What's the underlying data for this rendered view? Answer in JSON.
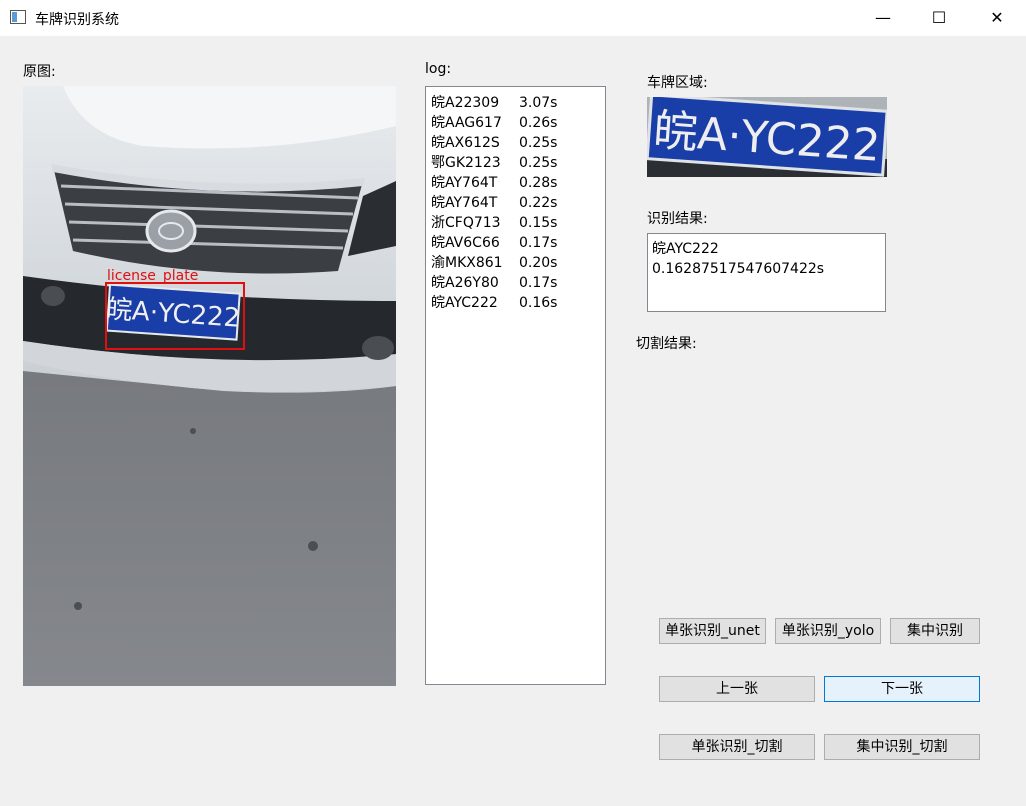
{
  "window": {
    "title": "车牌识别系统",
    "minimize": "—",
    "maximize": "☐",
    "close": "✕"
  },
  "labels": {
    "original": "原图:",
    "log": "log:",
    "plate_region": "车牌区域:",
    "result": "识别结果:",
    "segment": "切割结果:"
  },
  "photo": {
    "detection_label": "license_plate",
    "plate_text": "皖A·YC222"
  },
  "log": [
    {
      "plate": "皖A22309",
      "time": "3.07s"
    },
    {
      "plate": "皖AAG617",
      "time": "0.26s"
    },
    {
      "plate": "皖AX612S",
      "time": "0.25s"
    },
    {
      "plate": "鄂GK2123",
      "time": "0.25s"
    },
    {
      "plate": "皖AY764T",
      "time": "0.28s"
    },
    {
      "plate": "皖AY764T",
      "time": "0.22s"
    },
    {
      "plate": "浙CFQ713",
      "time": "0.15s"
    },
    {
      "plate": "皖AV6C66",
      "time": "0.17s"
    },
    {
      "plate": "渝MKX861",
      "time": "0.20s"
    },
    {
      "plate": "皖A26Y80",
      "time": "0.17s"
    },
    {
      "plate": "皖AYC222",
      "time": "0.16s"
    }
  ],
  "result": {
    "plate": "皖AYC222",
    "time": "0.16287517547607422s"
  },
  "buttons": {
    "single_unet": "单张识别_unet",
    "single_yolo": "单张识别_yolo",
    "batch": "集中识别",
    "prev": "上一张",
    "next": "下一张",
    "single_seg": "单张识别_切割",
    "batch_seg": "集中识别_切割"
  },
  "colors": {
    "plate_blue": "#1a3ea8",
    "detect_box": "#e01010",
    "focus_border": "#0078d7"
  }
}
